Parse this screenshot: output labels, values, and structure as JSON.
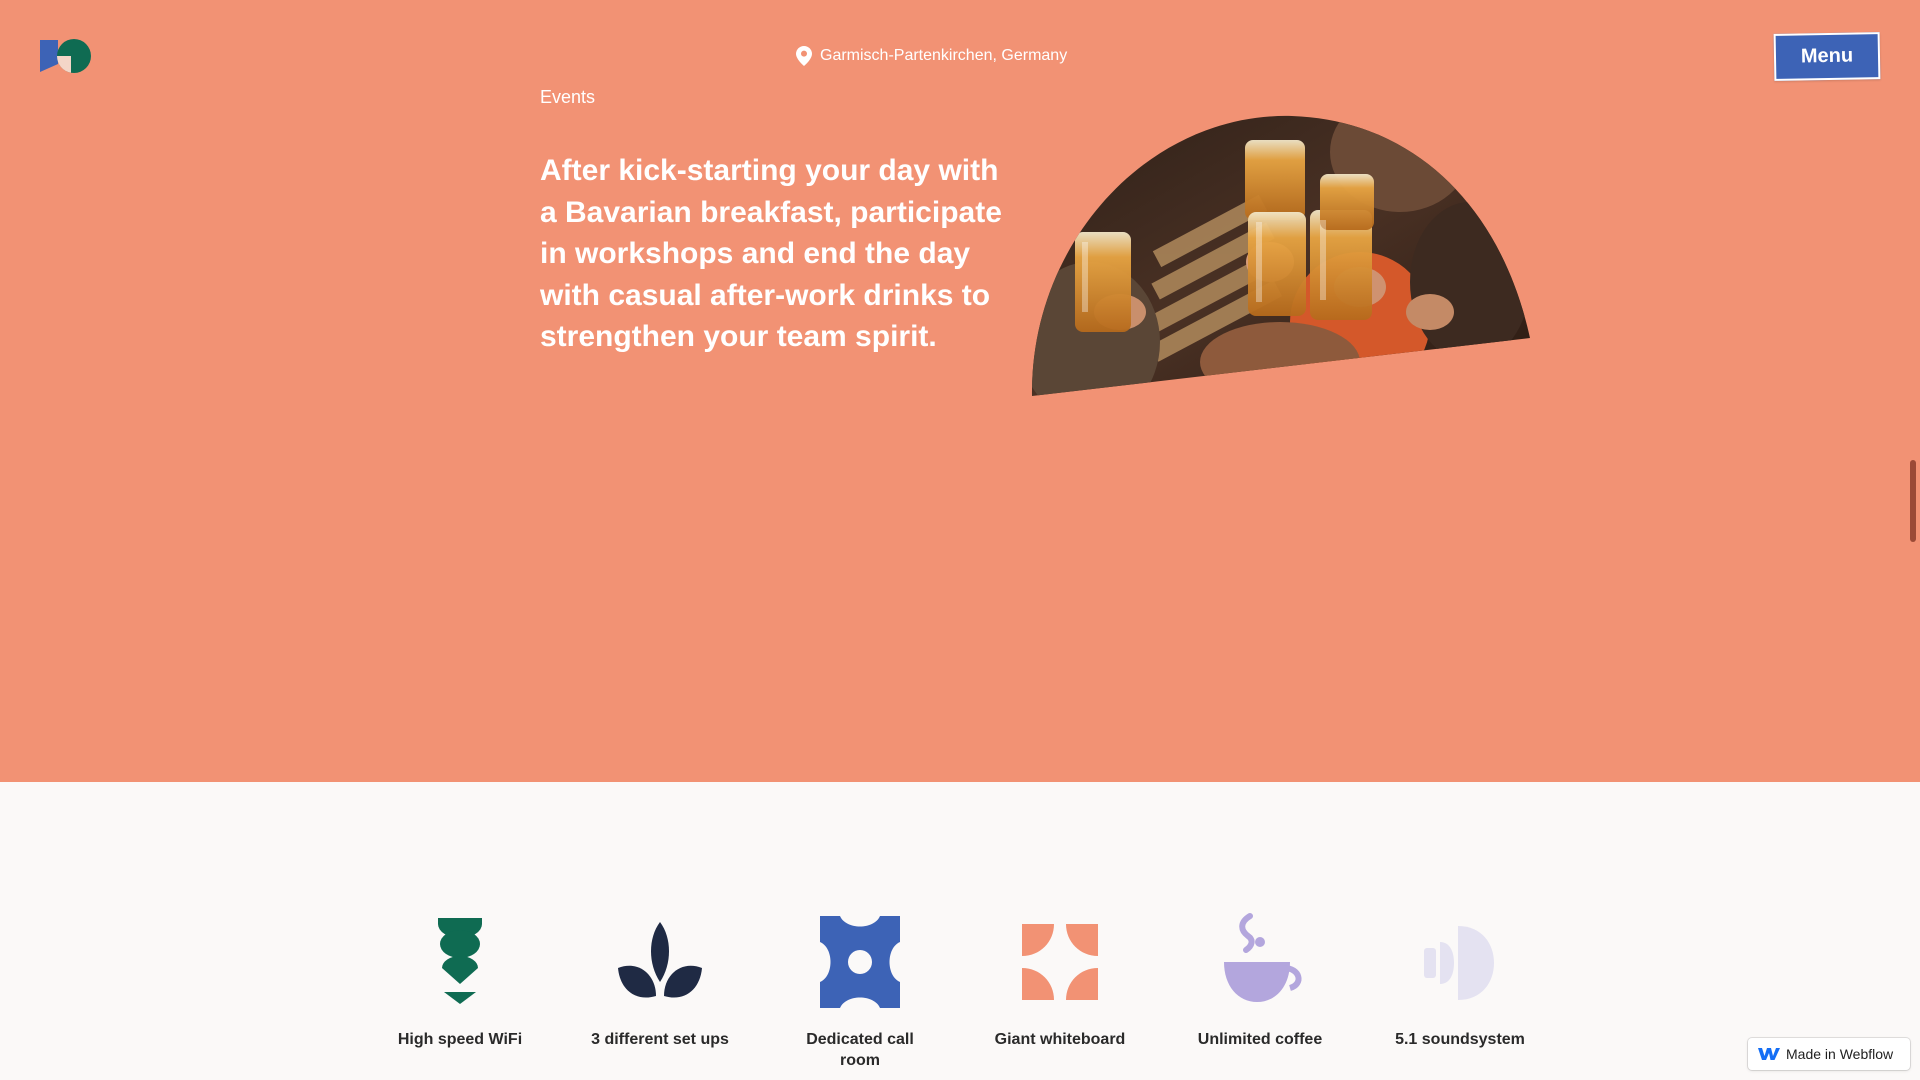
{
  "header": {
    "logo_icon": "brand-logo",
    "location_icon": "map-pin-icon",
    "location": "Garmisch-Partenkirchen, Germany",
    "menu_label": "Menu"
  },
  "hero": {
    "section_label": "Events",
    "headline": "After kick-starting your day with a Bavarian breakfast, participate in workshops and end the day with casual after-work drinks to strengthen your team spirit.",
    "photo_icon": "people-toasting-beer-photo"
  },
  "features": [
    {
      "icon": "wifi-icon",
      "label": "High speed WiFi"
    },
    {
      "icon": "leaf-icon",
      "label": "3 different set ups"
    },
    {
      "icon": "call-room-icon",
      "label": "Dedicated call room"
    },
    {
      "icon": "whiteboard-icon",
      "label": "Giant whiteboard"
    },
    {
      "icon": "coffee-icon",
      "label": "Unlimited coffee"
    },
    {
      "icon": "sound-icon",
      "label": "5.1 soundsystem"
    }
  ],
  "badge": {
    "icon": "webflow-logo-icon",
    "label": "Made in Webflow"
  },
  "colors": {
    "hero_background": "#f29274",
    "menu_button": "#3d63b6",
    "page_background": "#fbf9f8",
    "wifi_green": "#0f6b52",
    "leaf_navy": "#1f2a44",
    "callroom_blue": "#3d63b6",
    "whiteboard_orange": "#f29274",
    "coffee_purple": "#b3a6dd",
    "sound_lavender": "#e4e2f1"
  }
}
